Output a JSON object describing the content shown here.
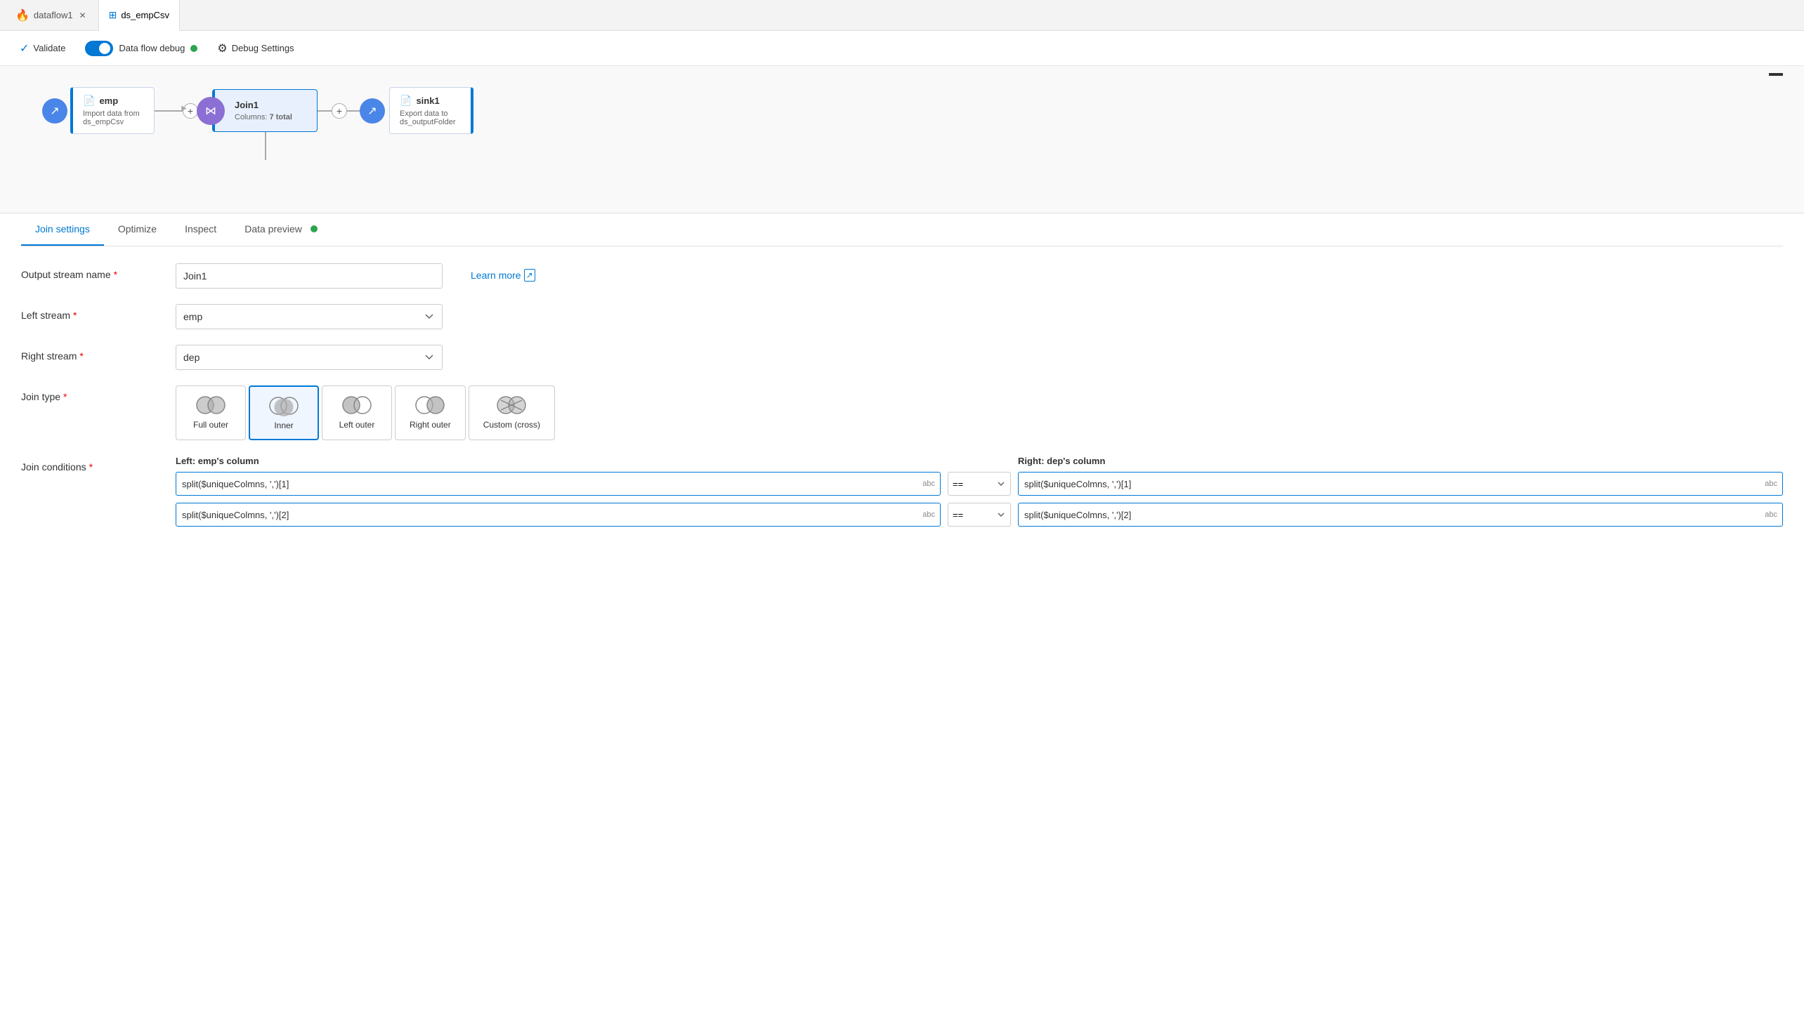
{
  "tabs": [
    {
      "id": "dataflow1",
      "label": "dataflow1",
      "icon": "🔥",
      "active": false,
      "closable": true
    },
    {
      "id": "ds_empCsv",
      "label": "ds_empCsv",
      "icon": "⊞",
      "active": true,
      "closable": false
    }
  ],
  "toolbar": {
    "validate_label": "Validate",
    "debug_label": "Data flow debug",
    "debug_settings_label": "Debug Settings"
  },
  "canvas": {
    "nodes": [
      {
        "id": "emp",
        "title": "emp",
        "subtitle": "Import data from",
        "sub2": "ds_empCsv",
        "type": "source"
      },
      {
        "id": "Join1",
        "title": "Join1",
        "columns_label": "Columns:",
        "columns_value": "7 total",
        "type": "join",
        "selected": true
      },
      {
        "id": "sink1",
        "title": "sink1",
        "subtitle": "Export data to",
        "sub2": "ds_outputFolder",
        "type": "sink"
      }
    ]
  },
  "settings": {
    "tabs": [
      {
        "id": "join-settings",
        "label": "Join settings",
        "active": true
      },
      {
        "id": "optimize",
        "label": "Optimize",
        "active": false
      },
      {
        "id": "inspect",
        "label": "Inspect",
        "active": false
      },
      {
        "id": "data-preview",
        "label": "Data preview",
        "active": false,
        "dot": true
      }
    ],
    "output_stream_name": {
      "label": "Output stream name",
      "required": true,
      "value": "Join1"
    },
    "left_stream": {
      "label": "Left stream",
      "required": true,
      "value": "emp",
      "options": [
        "emp",
        "dep"
      ]
    },
    "right_stream": {
      "label": "Right stream",
      "required": true,
      "value": "dep",
      "options": [
        "emp",
        "dep"
      ]
    },
    "join_type": {
      "label": "Join type",
      "required": true,
      "options": [
        {
          "id": "full-outer",
          "label": "Full outer"
        },
        {
          "id": "inner",
          "label": "Inner",
          "active": true
        },
        {
          "id": "left-outer",
          "label": "Left outer"
        },
        {
          "id": "right-outer",
          "label": "Right outer"
        },
        {
          "id": "custom-cross",
          "label": "Custom (cross)"
        }
      ]
    },
    "join_conditions": {
      "label": "Join conditions",
      "required": true,
      "left_header": "Left: emp's column",
      "right_header": "Right: dep's column",
      "rows": [
        {
          "left_value": "split($uniqueColmns, ',')[1]",
          "operator": "==",
          "right_value": "split($uniqueColmns, ',')[1]",
          "type": "abc"
        },
        {
          "left_value": "split($uniqueColmns, ',')[2]",
          "operator": "==",
          "right_value": "split($uniqueColmns, ',')[2]",
          "type": "abc"
        }
      ]
    },
    "learn_more_label": "Learn more"
  }
}
